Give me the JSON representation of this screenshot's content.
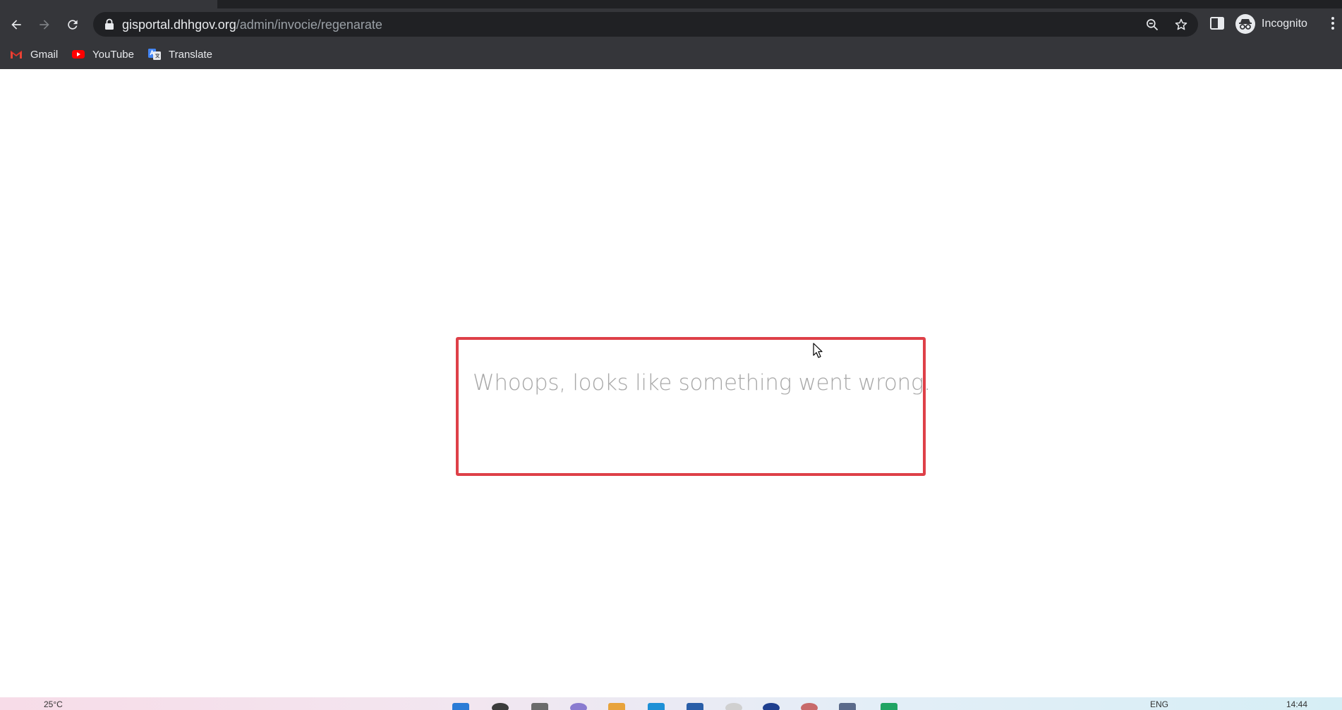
{
  "browser": {
    "address_host": "gisportal.dhhgov.org",
    "address_path": "/admin/invocie/regenarate",
    "profile_label": "Incognito",
    "bookmarks": [
      {
        "label": "Gmail",
        "icon": "gmail-icon"
      },
      {
        "label": "YouTube",
        "icon": "youtube-icon"
      },
      {
        "label": "Translate",
        "icon": "translate-icon"
      }
    ],
    "colors": {
      "toolbar": "#35363a",
      "omnibox": "#202124",
      "text": "#e8eaed"
    }
  },
  "page": {
    "error_message": "Whoops, looks like something went wrong.",
    "error_border_color": "#de4048"
  },
  "taskbar": {
    "weather": "25°C",
    "language": "ENG",
    "time": "14:44"
  }
}
